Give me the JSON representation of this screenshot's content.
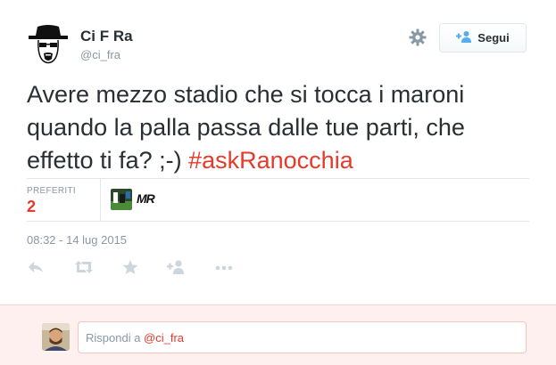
{
  "author": {
    "name": "Ci F Ra",
    "handle": "@ci_fra",
    "avatar_icon": "heisenberg-avatar-icon"
  },
  "header": {
    "gear_icon": "gear-icon",
    "follow_label": "Segui",
    "follow_icon": "add-user-icon"
  },
  "tweet": {
    "text": "Avere mezzo stadio che si tocca i maroni quando la palla passa dalle tue parti, che effetto ti fa? ;-) ",
    "hashtag": "#askRanocchia"
  },
  "stats": {
    "favorites_label": "PREFERITI",
    "favorites_count": "2",
    "faver_badge": "MR"
  },
  "timestamp": "08:32 - 14 lug 2015",
  "actions": [
    "reply-icon",
    "retweet-icon",
    "favorite-icon",
    "follow-icon",
    "more-icon"
  ],
  "reply": {
    "prefix": "Rispondi a ",
    "mention": "@ci_fra"
  },
  "colors": {
    "accent": "#e8392a",
    "muted": "#8899a6",
    "text": "#292f33",
    "reply_bg": "#fdf0ee"
  }
}
